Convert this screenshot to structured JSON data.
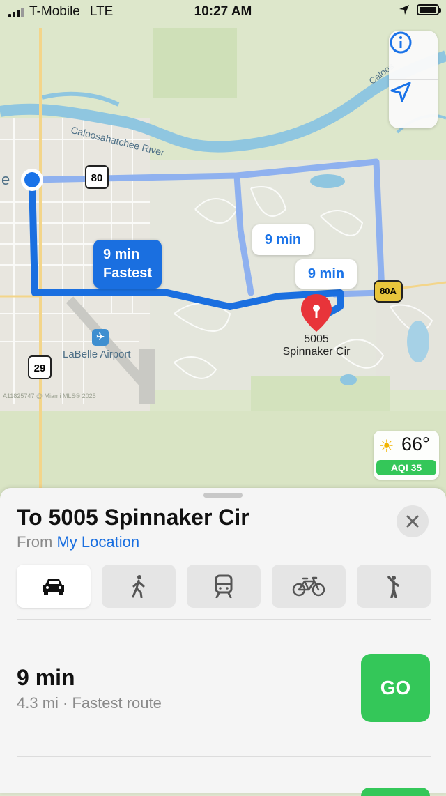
{
  "status_bar": {
    "carrier": "T-Mobile",
    "network": "LTE",
    "time": "10:27 AM"
  },
  "map": {
    "river_label": "Caloosahatchee River",
    "river_label_right": "Caloos",
    "left_edge_label": "e",
    "airport_label": "LaBelle Airport",
    "road_shields": [
      "80",
      "29",
      "80A"
    ],
    "watermark": "A11825747 @ Miami MLS® 2025",
    "route_callouts": {
      "primary_time": "9 min",
      "primary_label": "Fastest",
      "alt1_time": "9 min",
      "alt2_time": "9 min"
    },
    "destination_pin_line1": "5005",
    "destination_pin_line2": "Spinnaker Cir",
    "controls": {
      "info_icon": "info-icon",
      "location_icon": "location-arrow-icon"
    }
  },
  "weather": {
    "temperature": "66°",
    "aqi": "AQI 35"
  },
  "sheet": {
    "title": "To 5005 Spinnaker Cir",
    "from_prefix": "From",
    "from_location": "My Location",
    "modes": [
      {
        "icon": "car-icon",
        "selected": true
      },
      {
        "icon": "walk-icon",
        "selected": false
      },
      {
        "icon": "transit-icon",
        "selected": false
      },
      {
        "icon": "bike-icon",
        "selected": false
      },
      {
        "icon": "rideshare-icon",
        "selected": false
      }
    ],
    "route": {
      "time": "9 min",
      "details": "4.3 mi · Fastest route",
      "go_label": "GO"
    }
  },
  "colors": {
    "route_blue": "#1a6fe0",
    "go_green": "#34c759",
    "river": "#8fc6e0",
    "pin_red": "#e8343a"
  }
}
